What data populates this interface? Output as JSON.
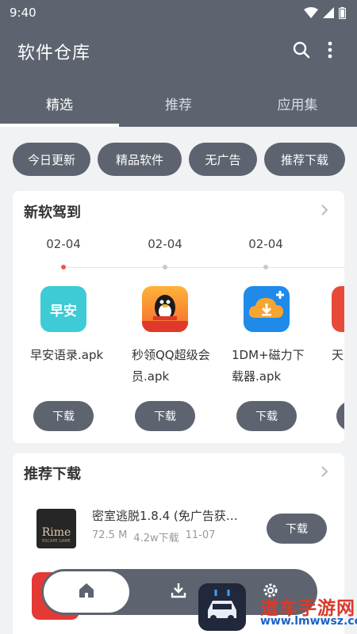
{
  "status_bar": {
    "time": "9:40"
  },
  "header": {
    "title": "软件仓库"
  },
  "tabs": [
    {
      "label": "精选",
      "active": true
    },
    {
      "label": "推荐",
      "active": false
    },
    {
      "label": "应用集",
      "active": false
    }
  ],
  "chips": [
    {
      "label": "今日更新"
    },
    {
      "label": "精品软件"
    },
    {
      "label": "无广告"
    },
    {
      "label": "推荐下载"
    }
  ],
  "new_apps": {
    "title": "新软驾到",
    "dates": [
      "02-04",
      "02-04",
      "02-04"
    ],
    "items": [
      {
        "name": "早安语录.apk",
        "icon": "morning-quotes-app-icon",
        "icon_text": "早安",
        "button": "下载"
      },
      {
        "name": "秒领QQ超级会员.apk",
        "icon": "qq-penguin-app-icon",
        "button": "下载"
      },
      {
        "name": "1DM+磁力下载器.apk",
        "icon": "cloud-download-app-icon",
        "button": "下载"
      },
      {
        "name": "天…v.a…",
        "icon": "partial-app-icon",
        "button": "下载"
      }
    ]
  },
  "recommend": {
    "title": "推荐下载",
    "items": [
      {
        "title": "密室逃脱1.8.4 (免广告获…",
        "size": "72.5 M",
        "downloads": "4.2w下载",
        "date": "11-07",
        "button": "下载",
        "icon": "escape-room-game-icon",
        "icon_text": "Rime",
        "icon_subtext": "ESCAPE GAME"
      }
    ]
  },
  "bottom_nav": {
    "items": [
      {
        "name": "home",
        "icon": "home-icon",
        "active": true
      },
      {
        "name": "downloads",
        "icon": "download-icon",
        "active": false
      },
      {
        "name": "settings",
        "icon": "gear-icon",
        "active": false
      }
    ]
  },
  "watermark": {
    "title": "道车手游网",
    "url": "www.lmwwsz.com"
  },
  "colors": {
    "primary": "#5d6470",
    "background": "#f1f2f4",
    "timeline_active": "#f05a3c"
  }
}
